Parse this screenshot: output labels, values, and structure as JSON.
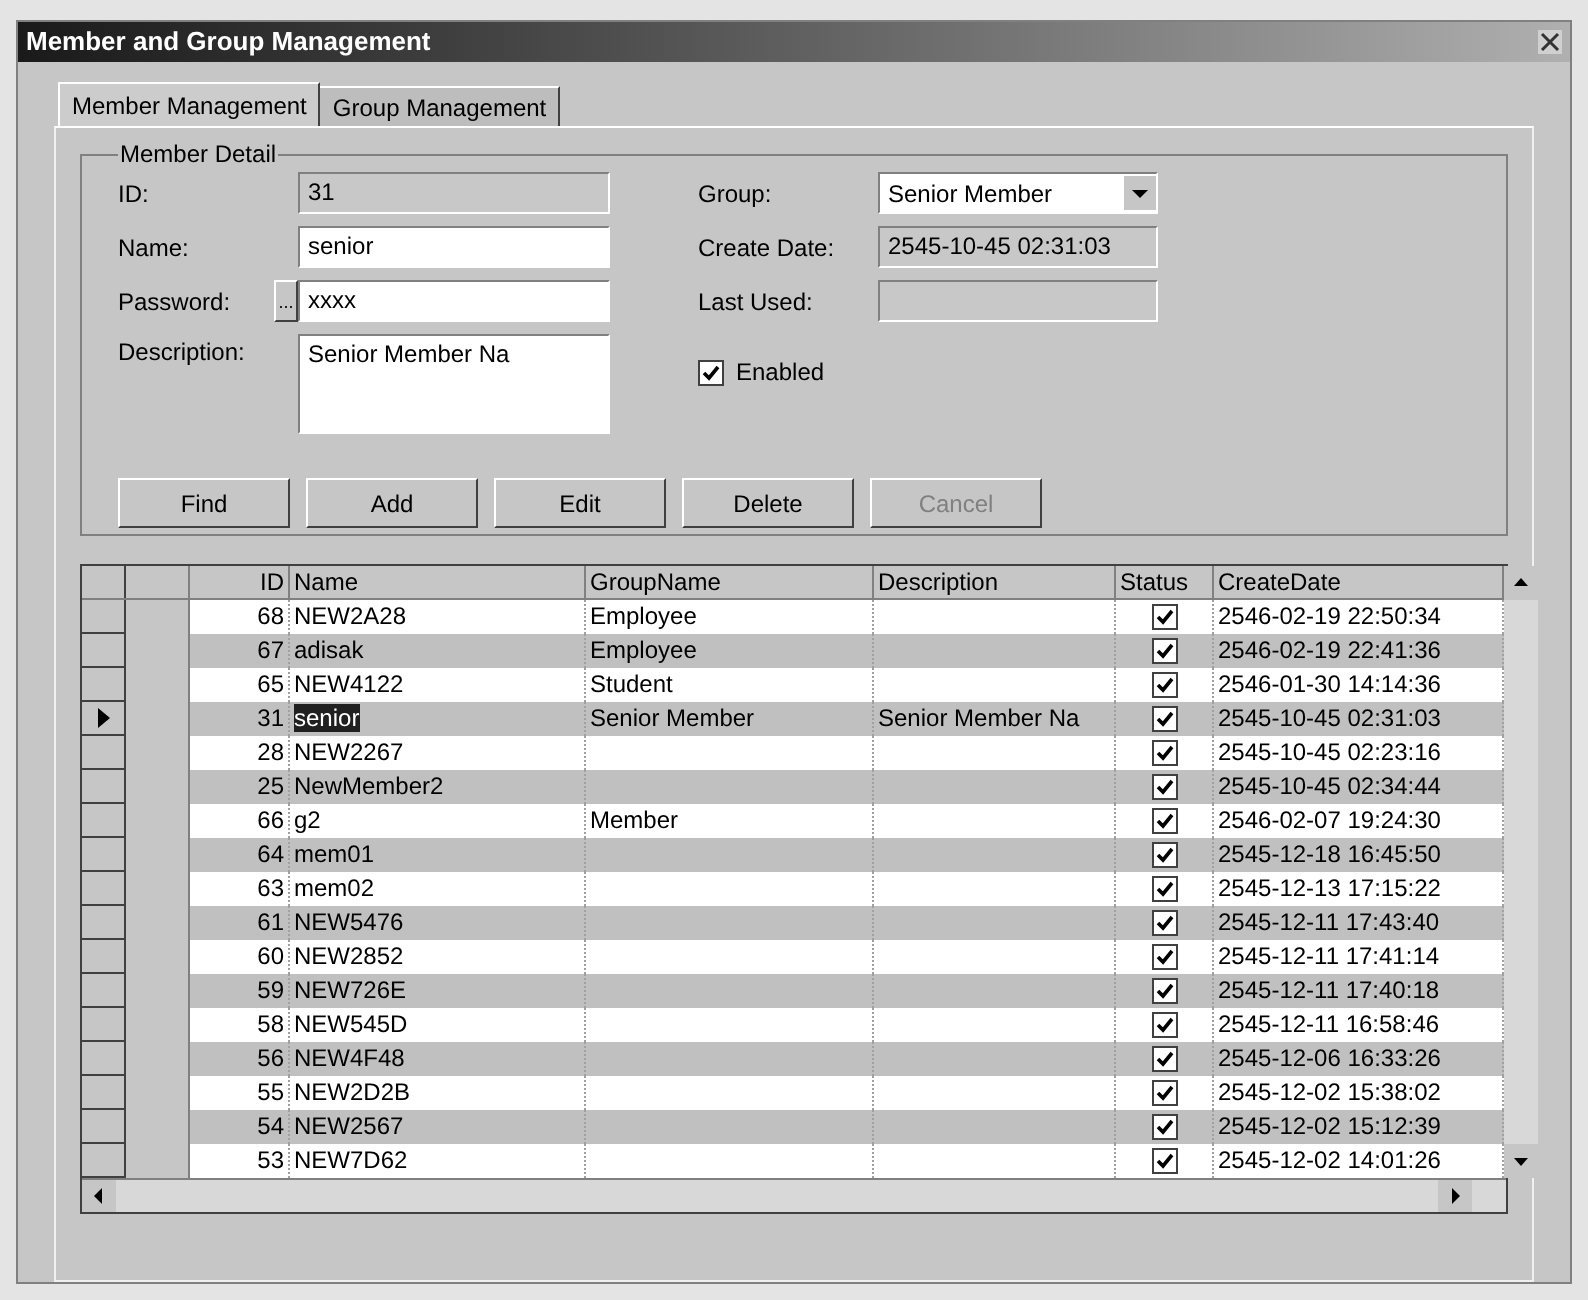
{
  "window": {
    "title": "Member and Group Management"
  },
  "tabs": [
    {
      "label": "Member Management",
      "selected": true
    },
    {
      "label": "Group Management",
      "selected": false
    }
  ],
  "member_detail": {
    "title": "Member Detail",
    "id": {
      "label": "ID:",
      "value": "31"
    },
    "name": {
      "label": "Name:",
      "value": "senior"
    },
    "password": {
      "label": "Password:",
      "button": "...",
      "value": "xxxx"
    },
    "description": {
      "label": "Description:",
      "value": "Senior Member Na"
    },
    "group": {
      "label": "Group:",
      "value": "Senior Member"
    },
    "create_date": {
      "label": "Create Date:",
      "value": "2545-10-45 02:31:03"
    },
    "last_used": {
      "label": "Last Used:"
    },
    "enabled": {
      "label": "Enabled",
      "checked": true
    }
  },
  "buttons": [
    {
      "label": "Find",
      "disabled": false
    },
    {
      "label": "Add",
      "disabled": false
    },
    {
      "label": "Edit",
      "disabled": false
    },
    {
      "label": "Delete",
      "disabled": false
    },
    {
      "label": "Cancel",
      "disabled": true
    }
  ],
  "table": {
    "columns": [
      "ID",
      "Name",
      "GroupName",
      "Description",
      "Status",
      "CreateDate"
    ],
    "rows": [
      {
        "id": "68",
        "name": "NEW2A28",
        "group": "Employee",
        "description": "",
        "status": true,
        "created": "2546-02-19 22:50:34",
        "selected": false
      },
      {
        "id": "67",
        "name": "adisak",
        "group": "Employee",
        "description": "",
        "status": true,
        "created": "2546-02-19 22:41:36",
        "selected": false
      },
      {
        "id": "65",
        "name": "NEW4122",
        "group": "Student",
        "description": "",
        "status": true,
        "created": "2546-01-30 14:14:36",
        "selected": false
      },
      {
        "id": "31",
        "name": "senior",
        "group": "Senior Member",
        "description": "Senior Member Na",
        "status": true,
        "created": "2545-10-45 02:31:03",
        "selected": true
      },
      {
        "id": "28",
        "name": "NEW2267",
        "group": "",
        "description": "",
        "status": true,
        "created": "2545-10-45 02:23:16",
        "selected": false
      },
      {
        "id": "25",
        "name": "NewMember2",
        "group": "",
        "description": "",
        "status": true,
        "created": "2545-10-45 02:34:44",
        "selected": false
      },
      {
        "id": "66",
        "name": "g2",
        "group": "Member",
        "description": "",
        "status": true,
        "created": "2546-02-07 19:24:30",
        "selected": false
      },
      {
        "id": "64",
        "name": "mem01",
        "group": "",
        "description": "",
        "status": true,
        "created": "2545-12-18 16:45:50",
        "selected": false
      },
      {
        "id": "63",
        "name": "mem02",
        "group": "",
        "description": "",
        "status": true,
        "created": "2545-12-13 17:15:22",
        "selected": false
      },
      {
        "id": "61",
        "name": "NEW5476",
        "group": "",
        "description": "",
        "status": true,
        "created": "2545-12-11 17:43:40",
        "selected": false
      },
      {
        "id": "60",
        "name": "NEW2852",
        "group": "",
        "description": "",
        "status": true,
        "created": "2545-12-11 17:41:14",
        "selected": false
      },
      {
        "id": "59",
        "name": "NEW726E",
        "group": "",
        "description": "",
        "status": true,
        "created": "2545-12-11 17:40:18",
        "selected": false
      },
      {
        "id": "58",
        "name": "NEW545D",
        "group": "",
        "description": "",
        "status": true,
        "created": "2545-12-11 16:58:46",
        "selected": false
      },
      {
        "id": "56",
        "name": "NEW4F48",
        "group": "",
        "description": "",
        "status": true,
        "created": "2545-12-06 16:33:26",
        "selected": false
      },
      {
        "id": "55",
        "name": "NEW2D2B",
        "group": "",
        "description": "",
        "status": true,
        "created": "2545-12-02 15:38:02",
        "selected": false
      },
      {
        "id": "54",
        "name": "NEW2567",
        "group": "",
        "description": "",
        "status": true,
        "created": "2545-12-02 15:12:39",
        "selected": false
      },
      {
        "id": "53",
        "name": "NEW7D62",
        "group": "",
        "description": "",
        "status": true,
        "created": "2545-12-02 14:01:26",
        "selected": false
      }
    ]
  }
}
